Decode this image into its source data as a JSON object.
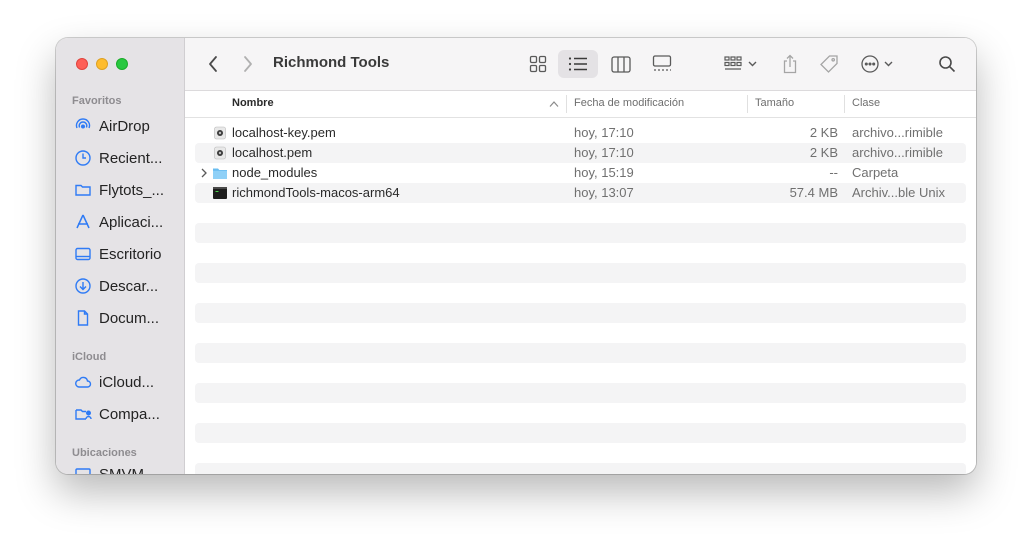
{
  "window": {
    "title": "Richmond Tools"
  },
  "sidebar": {
    "sections": [
      {
        "title": "Favoritos"
      },
      {
        "title": "iCloud"
      },
      {
        "title": "Ubicaciones"
      }
    ],
    "items": [
      {
        "label": "AirDrop",
        "icon": "airdrop-icon"
      },
      {
        "label": "Recient...",
        "icon": "clock-icon"
      },
      {
        "label": "Flytots_...",
        "icon": "folder-icon"
      },
      {
        "label": "Aplicaci...",
        "icon": "applications-icon"
      },
      {
        "label": "Escritorio",
        "icon": "desktop-icon"
      },
      {
        "label": "Descar...",
        "icon": "download-icon"
      },
      {
        "label": "Docum...",
        "icon": "document-icon"
      },
      {
        "label": "iCloud...",
        "icon": "cloud-icon"
      },
      {
        "label": "Compa...",
        "icon": "shared-folder-icon"
      },
      {
        "label": "SMVM...",
        "icon": "display-icon"
      }
    ]
  },
  "columns": {
    "name": "Nombre",
    "modified": "Fecha de modificación",
    "size": "Tamaño",
    "kind": "Clase"
  },
  "files": [
    {
      "name": "localhost-key.pem",
      "modified": "hoy, 17:10",
      "size": "2 KB",
      "kind": "archivo...rimible",
      "icon": "certificate-icon"
    },
    {
      "name": "localhost.pem",
      "modified": "hoy, 17:10",
      "size": "2 KB",
      "kind": "archivo...rimible",
      "icon": "certificate-icon"
    },
    {
      "name": "node_modules",
      "modified": "hoy, 15:19",
      "size": "--",
      "kind": "Carpeta",
      "icon": "folder-icon"
    },
    {
      "name": "richmondTools-macos-arm64",
      "modified": "hoy, 13:07",
      "size": "57.4 MB",
      "kind": "Archiv...ble Unix",
      "icon": "terminal-executable-icon"
    }
  ],
  "colors": {
    "accent": "#2f7bf5",
    "red": "#fe5f57",
    "yellow": "#febc2e",
    "green": "#28c840"
  }
}
